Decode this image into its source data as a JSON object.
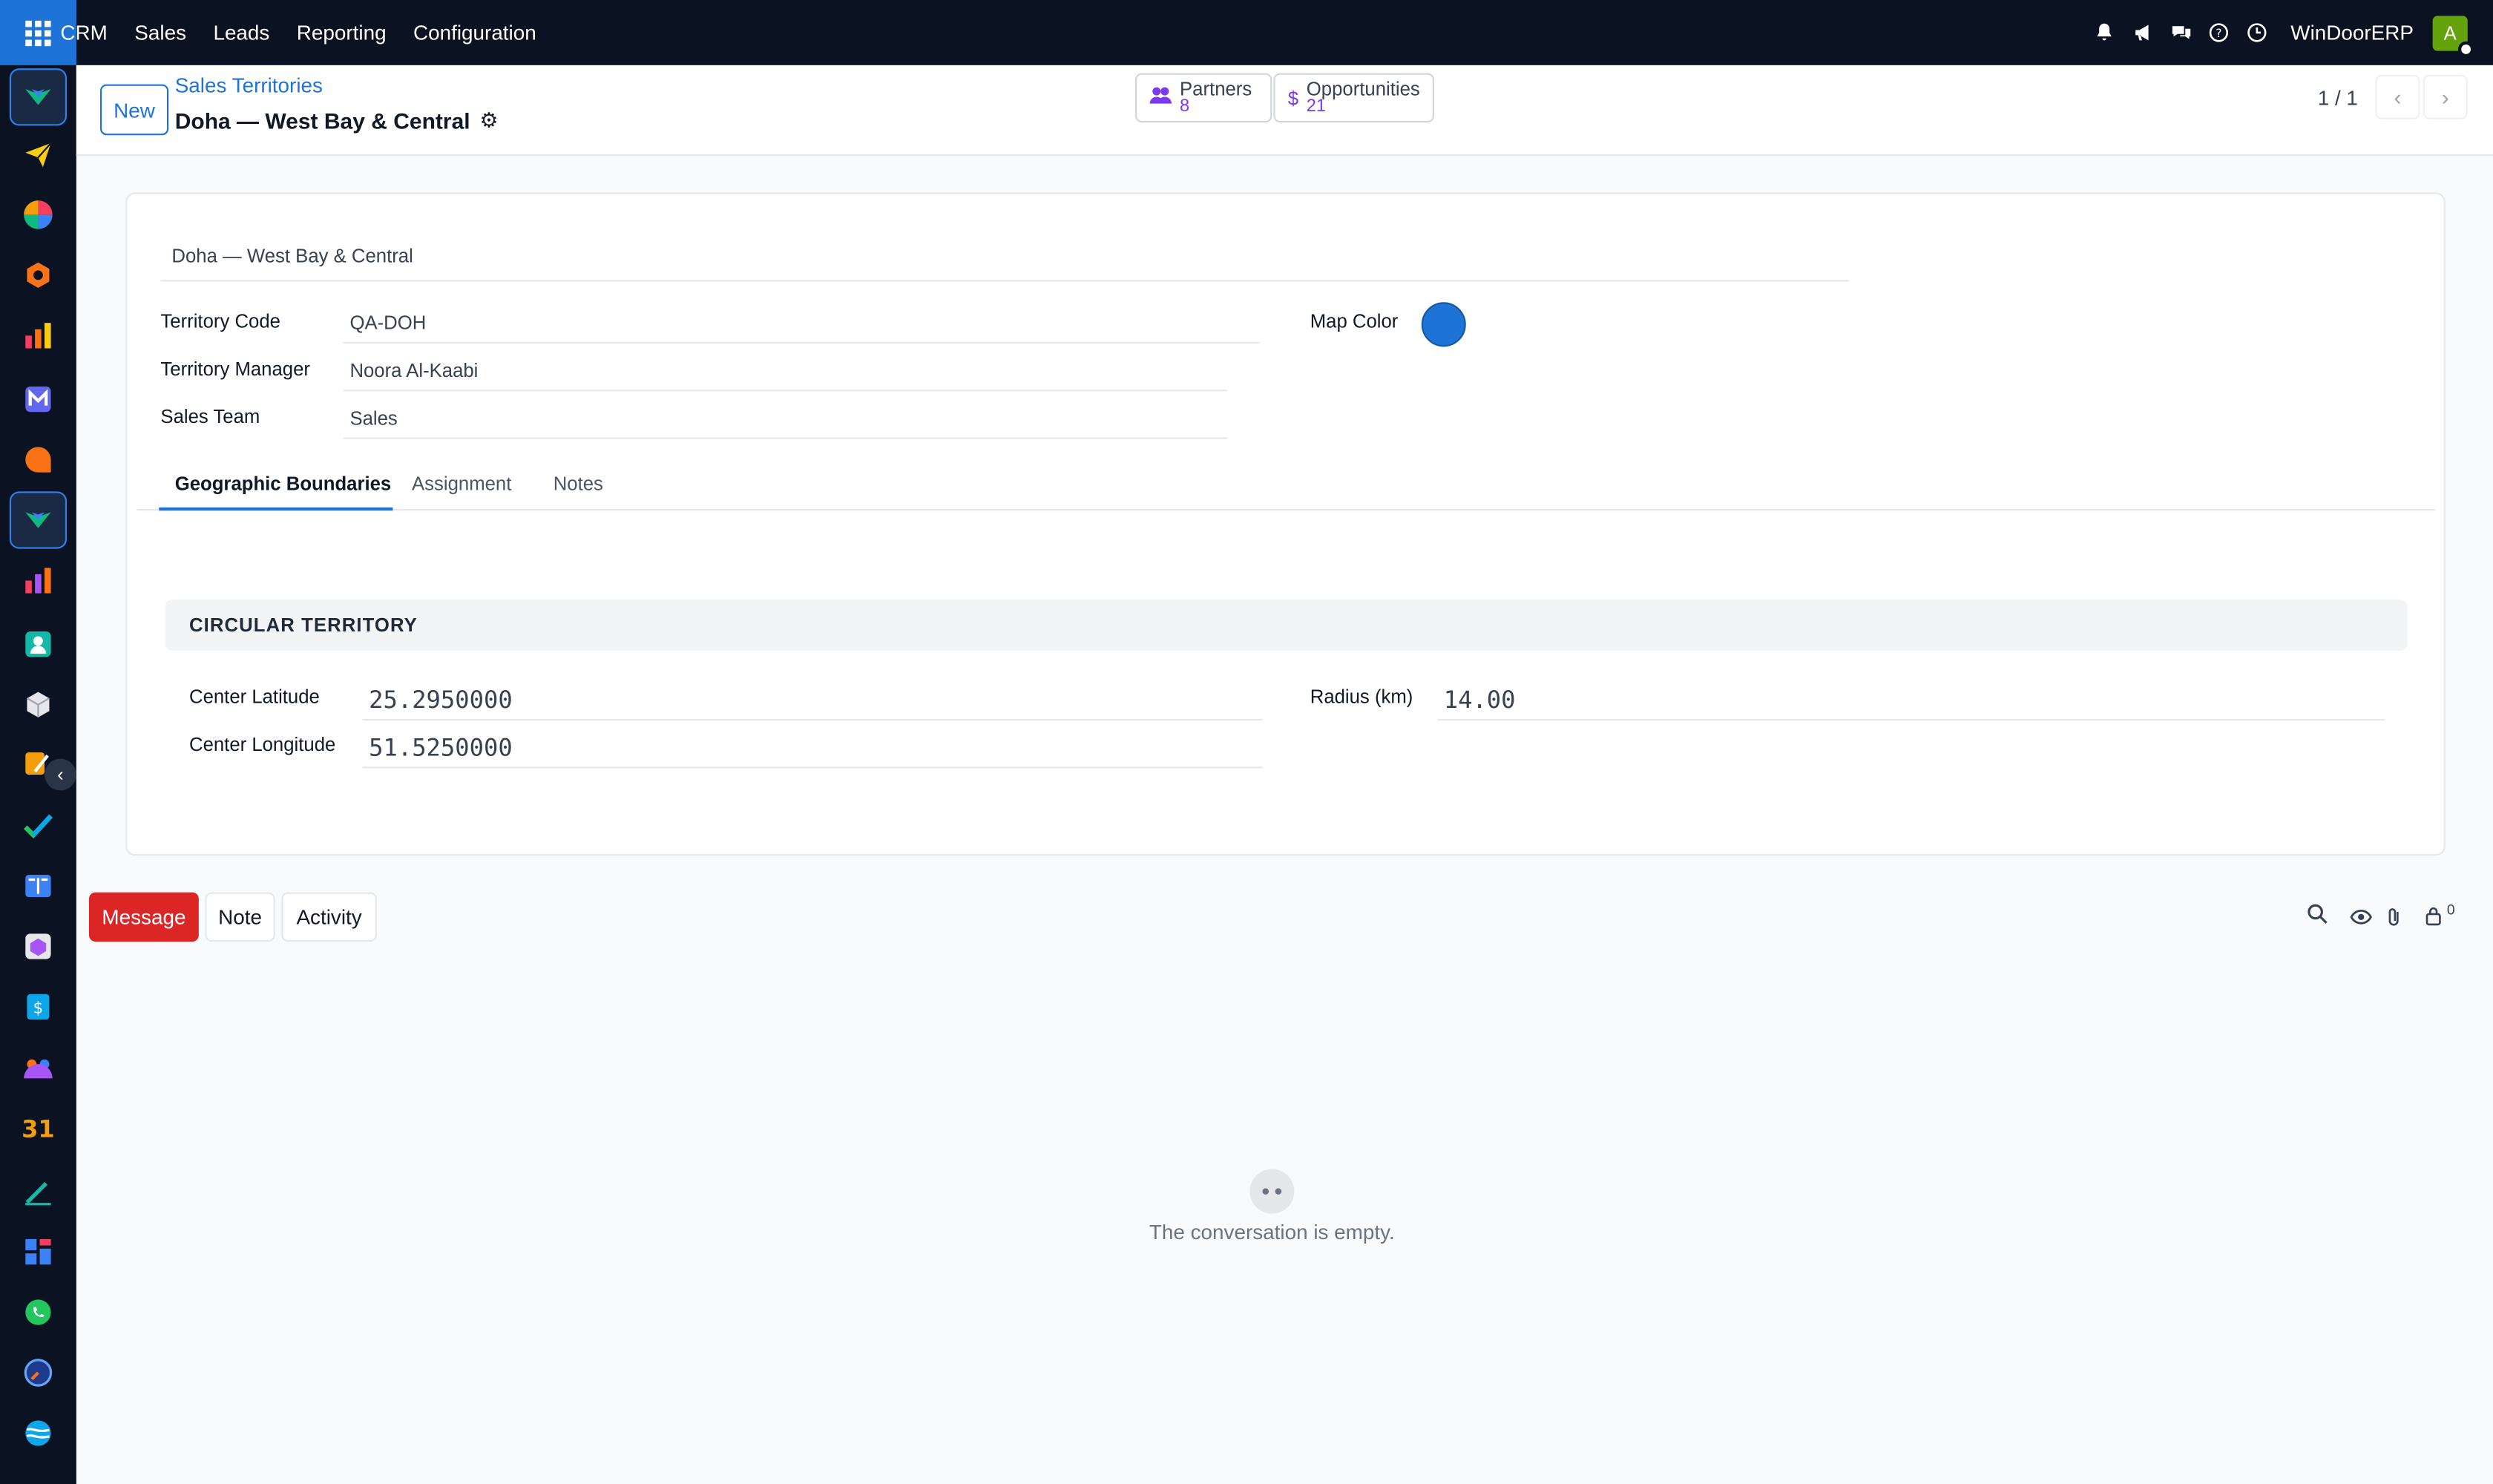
{
  "topbar": {
    "menu": [
      "CRM",
      "Sales",
      "Leads",
      "Reporting",
      "Configuration"
    ],
    "company": "WinDoorERP",
    "avatar_initial": "A"
  },
  "control": {
    "new_label": "New",
    "breadcrumb": "Sales Territories",
    "title": "Doha — West Bay & Central",
    "partners": {
      "label": "Partners",
      "value": "8"
    },
    "opportunities": {
      "label": "Opportunities",
      "value": "21"
    },
    "pager": "1 / 1"
  },
  "form": {
    "name": "Doha — West Bay & Central",
    "territory_code": {
      "label": "Territory Code",
      "value": "QA-DOH"
    },
    "territory_manager": {
      "label": "Territory Manager",
      "value": "Noora Al-Kaabi"
    },
    "sales_team": {
      "label": "Sales Team",
      "value": "Sales"
    },
    "map_color": {
      "label": "Map Color",
      "color": "#1e73d6"
    },
    "tabs": [
      "Geographic Boundaries",
      "Assignment",
      "Notes"
    ],
    "section_title": "CIRCULAR TERRITORY",
    "center_latitude": {
      "label": "Center Latitude",
      "value": "25.2950000"
    },
    "center_longitude": {
      "label": "Center Longitude",
      "value": "51.5250000"
    },
    "radius": {
      "label": "Radius (km)",
      "value": "14.00"
    }
  },
  "chatter": {
    "message_label": "Message",
    "note_label": "Note",
    "activity_label": "Activity",
    "followers_count": "0",
    "empty_text": "The conversation is empty."
  },
  "colors": {
    "nav_bg": "#0b1221",
    "accent": "#1e73d6",
    "message_btn": "#dc2626"
  }
}
